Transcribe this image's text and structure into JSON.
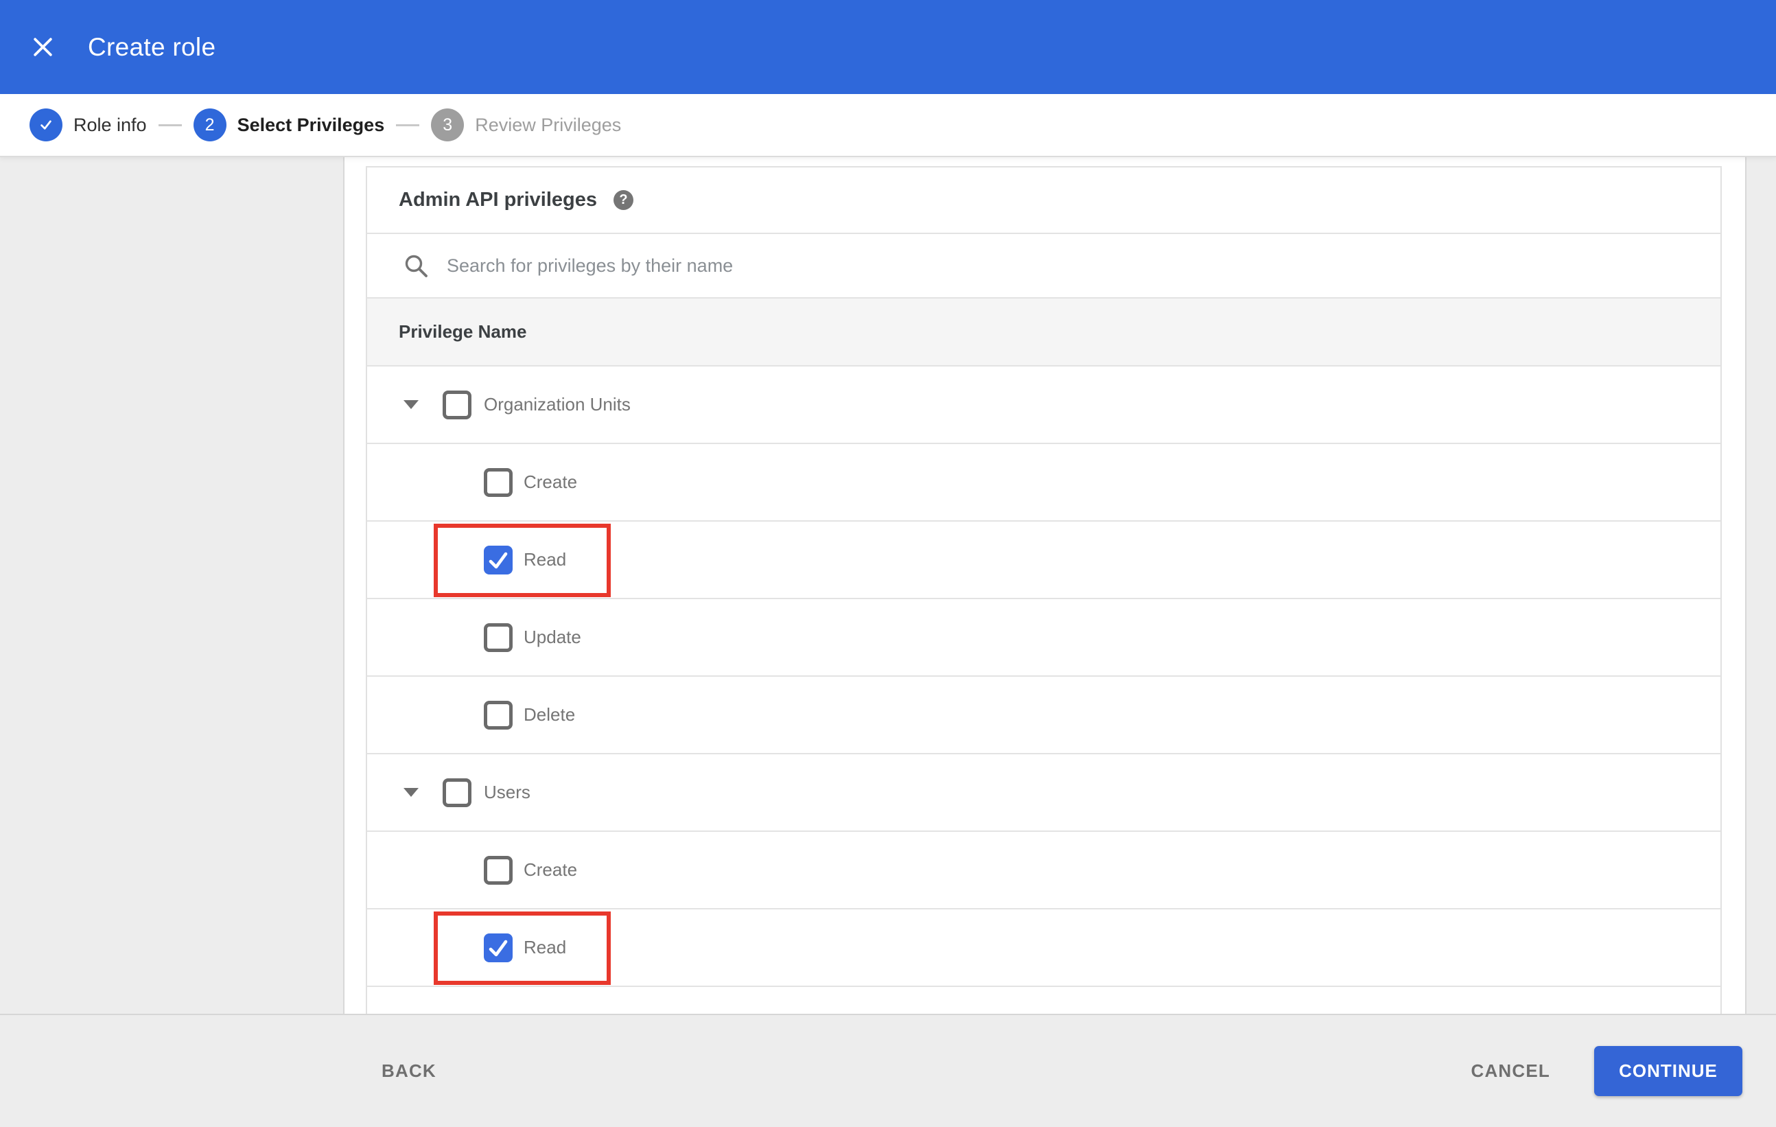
{
  "header": {
    "title": "Create role",
    "close_icon": "x-icon"
  },
  "stepper": {
    "steps": [
      {
        "label": "Role info",
        "state": "done",
        "icon": "check-icon"
      },
      {
        "number": "2",
        "label": "Select Privileges",
        "state": "active"
      },
      {
        "number": "3",
        "label": "Review Privileges",
        "state": "upcoming"
      }
    ]
  },
  "panel": {
    "heading": "Admin API privileges",
    "help_glyph": "?",
    "search": {
      "placeholder": "Search for privileges by their name",
      "value": "",
      "icon": "search-icon"
    },
    "table": {
      "header": "Privilege Name",
      "groups": [
        {
          "label": "Organization Units",
          "expanded": true,
          "checked": false,
          "children": [
            {
              "label": "Create",
              "checked": false,
              "highlighted": false
            },
            {
              "label": "Read",
              "checked": true,
              "highlighted": true
            },
            {
              "label": "Update",
              "checked": false,
              "highlighted": false
            },
            {
              "label": "Delete",
              "checked": false,
              "highlighted": false
            }
          ]
        },
        {
          "label": "Users",
          "expanded": true,
          "checked": false,
          "children": [
            {
              "label": "Create",
              "checked": false,
              "highlighted": false
            },
            {
              "label": "Read",
              "checked": true,
              "highlighted": true
            }
          ]
        }
      ]
    }
  },
  "footer": {
    "back_label": "BACK",
    "cancel_label": "CANCEL",
    "continue_label": "CONTINUE"
  },
  "colors": {
    "primary_blue": "#2f68da",
    "checkbox_blue": "#3a6de2",
    "continue_blue": "#3465d6",
    "highlight_red": "#e8382c",
    "page_gray": "#ededed",
    "divider": "#e3e3e3",
    "text_dark": "#3c4043",
    "text_gray": "#757575",
    "text_inactive": "#9e9e9e"
  }
}
